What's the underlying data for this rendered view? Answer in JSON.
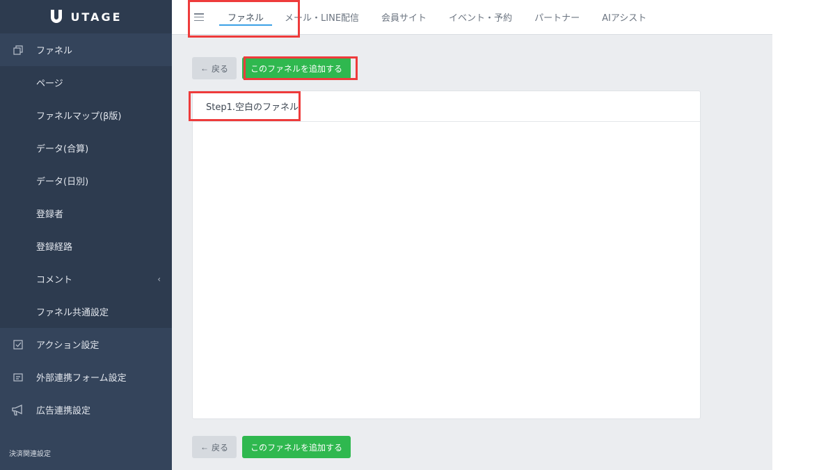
{
  "logo": {
    "text": "UTAGE"
  },
  "sidebar": {
    "top_item": {
      "label": "ファネル",
      "icon": "copy-icon"
    },
    "sub_items": [
      {
        "label": "ページ"
      },
      {
        "label": "ファネルマップ(β版)"
      },
      {
        "label": "データ(合算)"
      },
      {
        "label": "データ(日別)"
      },
      {
        "label": "登録者"
      },
      {
        "label": "登録経路"
      },
      {
        "label": "コメント",
        "chevron": "‹"
      },
      {
        "label": "ファネル共通設定"
      }
    ],
    "items": [
      {
        "label": "アクション設定",
        "icon": "checkbox-icon"
      },
      {
        "label": "外部連携フォーム設定",
        "icon": "form-icon"
      },
      {
        "label": "広告連携設定",
        "icon": "megaphone-icon"
      }
    ],
    "section_title": "決済関連設定"
  },
  "topbar": {
    "tabs": [
      {
        "label": "ファネル",
        "active": true
      },
      {
        "label": "メール・LINE配信"
      },
      {
        "label": "会員サイト"
      },
      {
        "label": "イベント・予約"
      },
      {
        "label": "パートナー"
      },
      {
        "label": "AIアシスト"
      }
    ]
  },
  "actions": {
    "back_label": "戻る",
    "back_arrow": "←",
    "add_label": "このファネルを追加する"
  },
  "card": {
    "title": "Step1.空白のファネル"
  },
  "colors": {
    "sidebar_bg": "#34445b",
    "accent_blue": "#3aa0e6",
    "add_green": "#2fb84f",
    "highlight_red": "#ee3b3b"
  }
}
